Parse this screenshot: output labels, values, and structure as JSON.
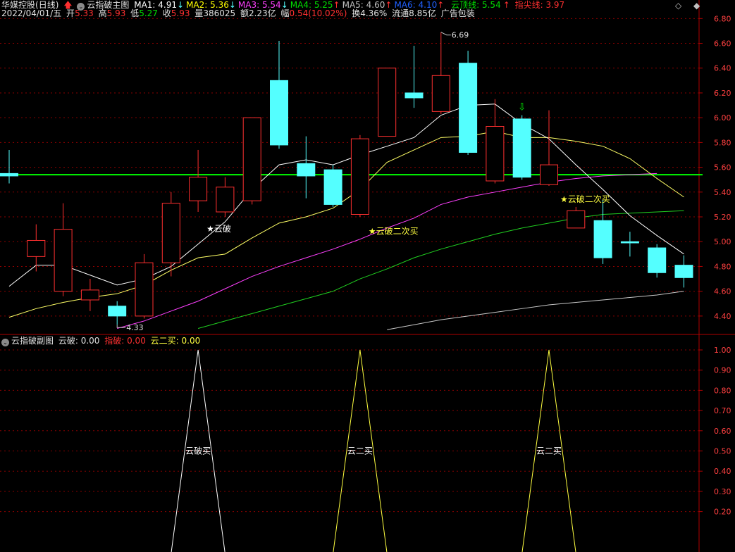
{
  "header": {
    "stock_name": "华媒控股",
    "period": "(日线)",
    "main_indicator": "云指破主图",
    "ma": [
      {
        "label": "MA1: 4.91",
        "color": "#ffffff",
        "dir": "down"
      },
      {
        "label": "MA2: 5.36",
        "color": "#ffff00",
        "dir": "down"
      },
      {
        "label": "MA3: 5.54",
        "color": "#ff40ff",
        "dir": "down"
      },
      {
        "label": "MA4: 5.25",
        "color": "#00e000",
        "dir": "up"
      },
      {
        "label": "MA5: 4.60",
        "color": "#c0c0c0",
        "dir": "up"
      },
      {
        "label": "MA6: 4.10",
        "color": "#2060ff",
        "dir": "up"
      }
    ],
    "yun_top": "云顶线: 5.54",
    "zhi_jian": "指尖线: 3.97",
    "date": "2022/04/01/五",
    "open_lbl": "开",
    "open": "5.33",
    "high_lbl": "高",
    "high": "5.93",
    "low_lbl": "低",
    "low": "5.27",
    "close_lbl": "收",
    "close": "5.93",
    "vol_lbl": "量",
    "vol": "386025",
    "amt": "额2.23亿",
    "chg_lbl": "幅",
    "chg": "0.54(10.02%)",
    "turnover": "换4.36%",
    "float_cap": "流通8.85亿",
    "ad": "广告包装"
  },
  "sub_header": {
    "name": "云指破副图",
    "yunpo": "云破: 0.00",
    "zhipo": "指破: 0.00",
    "yun2": "云二买: 0.00"
  },
  "colors": {
    "up": "#ff3030",
    "down": "#54ffff",
    "grid": "#8b0000",
    "axis_text": "#ff4040",
    "green_line": "#00ff00",
    "ma1": "#ffffff",
    "ma2": "#ffff66",
    "ma3": "#ff40ff",
    "ma4": "#20d020",
    "ma5": "#c8c8c8",
    "signal_white": "#ffffff",
    "signal_yellow": "#ffff40"
  },
  "y_axis_main": [
    "6.80",
    "6.60",
    "6.40",
    "6.20",
    "6.00",
    "5.80",
    "5.60",
    "5.40",
    "5.20",
    "5.00",
    "4.80",
    "4.60",
    "4.40"
  ],
  "y_axis_sub": [
    "1.00",
    "0.90",
    "0.80",
    "0.70",
    "0.60",
    "0.50",
    "0.40",
    "0.30",
    "0.20"
  ],
  "price_range": [
    4.28,
    6.87
  ],
  "sub_range": [
    0,
    1.0
  ],
  "candles": [
    {
      "o": 5.55,
      "c": 5.53,
      "h": 5.74,
      "l": 5.47
    },
    {
      "o": 4.88,
      "c": 5.01,
      "h": 5.14,
      "l": 4.76
    },
    {
      "o": 4.6,
      "c": 5.1,
      "h": 5.31,
      "l": 4.56
    },
    {
      "o": 4.53,
      "c": 4.61,
      "h": 4.7,
      "l": 4.44
    },
    {
      "o": 4.48,
      "c": 4.4,
      "h": 4.52,
      "l": 4.33
    },
    {
      "o": 4.4,
      "c": 4.83,
      "h": 4.9,
      "l": 4.38
    },
    {
      "o": 4.83,
      "c": 5.31,
      "h": 5.4,
      "l": 4.72
    },
    {
      "o": 5.33,
      "c": 5.52,
      "h": 5.74,
      "l": 5.24
    },
    {
      "o": 5.24,
      "c": 5.44,
      "h": 5.52,
      "l": 5.2
    },
    {
      "o": 5.33,
      "c": 6.0,
      "h": 6.0,
      "l": 5.3
    },
    {
      "o": 6.3,
      "c": 5.78,
      "h": 6.62,
      "l": 5.75
    },
    {
      "o": 5.63,
      "c": 5.53,
      "h": 5.85,
      "l": 5.35
    },
    {
      "o": 5.58,
      "c": 5.3,
      "h": 5.62,
      "l": 5.28
    },
    {
      "o": 5.22,
      "c": 5.83,
      "h": 5.86,
      "l": 5.2
    },
    {
      "o": 5.85,
      "c": 6.4,
      "h": 6.4,
      "l": 5.85
    },
    {
      "o": 6.2,
      "c": 6.16,
      "h": 6.58,
      "l": 6.08
    },
    {
      "o": 6.05,
      "c": 6.34,
      "h": 6.69,
      "l": 6.03
    },
    {
      "o": 6.44,
      "c": 5.72,
      "h": 6.54,
      "l": 5.7
    },
    {
      "o": 5.49,
      "c": 5.93,
      "h": 6.15,
      "l": 5.47
    },
    {
      "o": 5.99,
      "c": 5.52,
      "h": 6.02,
      "l": 5.5
    },
    {
      "o": 5.46,
      "c": 5.62,
      "h": 6.06,
      "l": 5.45
    },
    {
      "o": 5.11,
      "c": 5.25,
      "h": 5.28,
      "l": 5.11
    },
    {
      "o": 5.17,
      "c": 4.87,
      "h": 5.34,
      "l": 4.82
    },
    {
      "o": 5.0,
      "c": 4.99,
      "h": 5.08,
      "l": 4.88
    },
    {
      "o": 4.95,
      "c": 4.75,
      "h": 4.98,
      "l": 4.71
    },
    {
      "o": 4.81,
      "c": 4.71,
      "h": 4.89,
      "l": 4.63
    }
  ],
  "ma_lines": {
    "ma1": [
      [
        0,
        4.64
      ],
      [
        1,
        4.81
      ],
      [
        2,
        4.81
      ],
      [
        3,
        4.73
      ],
      [
        4,
        4.65
      ],
      [
        5,
        4.7
      ],
      [
        6,
        4.8
      ],
      [
        7,
        4.98
      ],
      [
        8,
        5.16
      ],
      [
        9,
        5.42
      ],
      [
        10,
        5.62
      ],
      [
        11,
        5.66
      ],
      [
        12,
        5.62
      ],
      [
        13,
        5.7
      ],
      [
        14,
        5.77
      ],
      [
        15,
        5.84
      ],
      [
        16,
        6.02
      ],
      [
        17,
        6.1
      ],
      [
        18,
        6.11
      ],
      [
        19,
        5.95
      ],
      [
        20,
        5.83
      ],
      [
        21,
        5.62
      ],
      [
        22,
        5.42
      ],
      [
        23,
        5.21
      ],
      [
        24,
        5.05
      ],
      [
        25,
        4.9
      ]
    ],
    "ma2": [
      [
        0,
        4.39
      ],
      [
        1,
        4.46
      ],
      [
        2,
        4.51
      ],
      [
        3,
        4.55
      ],
      [
        4,
        4.58
      ],
      [
        5,
        4.65
      ],
      [
        6,
        4.77
      ],
      [
        7,
        4.87
      ],
      [
        8,
        4.9
      ],
      [
        9,
        5.03
      ],
      [
        10,
        5.15
      ],
      [
        11,
        5.2
      ],
      [
        12,
        5.27
      ],
      [
        13,
        5.42
      ],
      [
        14,
        5.64
      ],
      [
        15,
        5.74
      ],
      [
        16,
        5.84
      ],
      [
        17,
        5.85
      ],
      [
        18,
        5.89
      ],
      [
        19,
        5.84
      ],
      [
        20,
        5.84
      ],
      [
        21,
        5.81
      ],
      [
        22,
        5.77
      ],
      [
        23,
        5.67
      ],
      [
        24,
        5.51
      ],
      [
        25,
        5.36
      ]
    ],
    "ma3": [
      [
        4,
        4.3
      ],
      [
        5,
        4.36
      ],
      [
        6,
        4.44
      ],
      [
        7,
        4.52
      ],
      [
        8,
        4.62
      ],
      [
        9,
        4.72
      ],
      [
        10,
        4.8
      ],
      [
        11,
        4.87
      ],
      [
        12,
        4.94
      ],
      [
        13,
        5.02
      ],
      [
        14,
        5.11
      ],
      [
        15,
        5.19
      ],
      [
        16,
        5.3
      ],
      [
        17,
        5.36
      ],
      [
        18,
        5.4
      ],
      [
        19,
        5.44
      ],
      [
        20,
        5.48
      ],
      [
        21,
        5.51
      ],
      [
        22,
        5.53
      ],
      [
        23,
        5.54
      ],
      [
        24,
        5.55
      ]
    ],
    "ma4": [
      [
        7,
        4.3
      ],
      [
        8,
        4.36
      ],
      [
        9,
        4.42
      ],
      [
        10,
        4.48
      ],
      [
        11,
        4.54
      ],
      [
        12,
        4.6
      ],
      [
        13,
        4.7
      ],
      [
        14,
        4.78
      ],
      [
        15,
        4.87
      ],
      [
        16,
        4.94
      ],
      [
        17,
        5.0
      ],
      [
        18,
        5.06
      ],
      [
        19,
        5.11
      ],
      [
        20,
        5.15
      ],
      [
        21,
        5.19
      ],
      [
        22,
        5.22
      ],
      [
        23,
        5.23
      ],
      [
        24,
        5.24
      ],
      [
        25,
        5.25
      ]
    ],
    "ma5": [
      [
        14,
        4.29
      ],
      [
        15,
        4.33
      ],
      [
        16,
        4.37
      ],
      [
        17,
        4.4
      ],
      [
        18,
        4.43
      ],
      [
        19,
        4.46
      ],
      [
        20,
        4.49
      ],
      [
        21,
        4.51
      ],
      [
        22,
        4.53
      ],
      [
        23,
        4.55
      ],
      [
        24,
        4.57
      ],
      [
        25,
        4.6
      ]
    ]
  },
  "yun_top_value": 5.54,
  "annotations": {
    "high_label": "6.69",
    "low_label": "4.33",
    "yunpo_label": "★云破",
    "yun2_label_a": "★云破二次买",
    "yun2_label_b": "★云破二次买",
    "green_arrow": "⇩"
  },
  "sub_signals": [
    {
      "idx": 7,
      "label": "云破买",
      "color": "white"
    },
    {
      "idx": 13,
      "label": "云二买",
      "color": "yellow"
    },
    {
      "idx": 20,
      "label": "云二买",
      "color": "yellow"
    }
  ]
}
